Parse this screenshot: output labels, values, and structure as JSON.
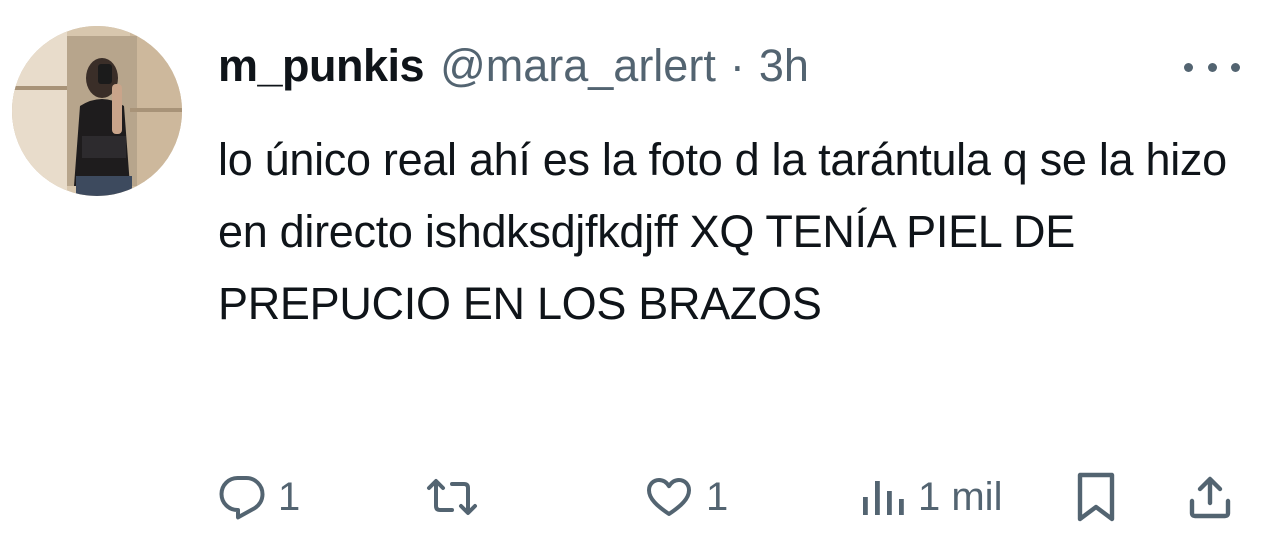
{
  "tweet": {
    "display_name": "m_punkis",
    "handle": "@mara_arlert",
    "separator": "·",
    "time": "3h",
    "text": "lo único real ahí es la foto d la tarántula q se la hizo en directo ishdksdjfkdjff XQ TENÍA PIEL DE PREPUCIO EN LOS BRAZOS",
    "more_icon": "ellipsis-icon"
  },
  "actions": {
    "reply": {
      "icon": "reply-icon",
      "count": "1"
    },
    "retweet": {
      "icon": "retweet-icon"
    },
    "like": {
      "icon": "heart-icon",
      "count": "1"
    },
    "views": {
      "icon": "views-icon",
      "count": "1 mil"
    },
    "bookmark": {
      "icon": "bookmark-icon"
    },
    "share": {
      "icon": "share-icon"
    }
  },
  "colors": {
    "text": "#0f1419",
    "muted": "#536471",
    "background": "#ffffff"
  }
}
